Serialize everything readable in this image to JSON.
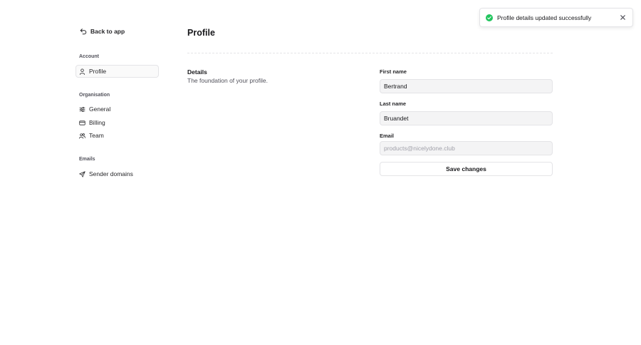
{
  "sidebar": {
    "back_label": "Back to app",
    "groups": [
      {
        "label": "Account",
        "items": [
          {
            "label": "Profile",
            "icon": "user-icon",
            "active": true
          }
        ]
      },
      {
        "label": "Organisation",
        "items": [
          {
            "label": "General",
            "icon": "sliders-icon"
          },
          {
            "label": "Billing",
            "icon": "credit-card-icon"
          },
          {
            "label": "Team",
            "icon": "users-icon"
          }
        ]
      },
      {
        "label": "Emails",
        "items": [
          {
            "label": "Sender domains",
            "icon": "send-icon"
          }
        ]
      }
    ]
  },
  "page": {
    "title": "Profile",
    "section_title": "Details",
    "section_description": "The foundation of your profile."
  },
  "form": {
    "first_name_label": "First name",
    "first_name_value": "Bertrand",
    "last_name_label": "Last name",
    "last_name_value": "Bruandet",
    "email_label": "Email",
    "email_placeholder": "products@nicelydone.club",
    "save_label": "Save changes"
  },
  "toast": {
    "message": "Profile details updated successfully",
    "icon": "check-circle-icon",
    "icon_color": "#22c55e"
  }
}
